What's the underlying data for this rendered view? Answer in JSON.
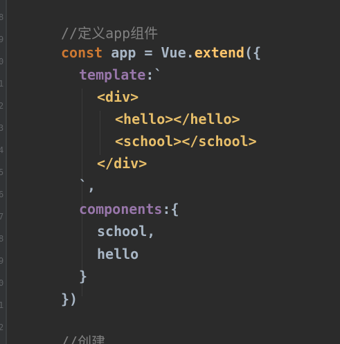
{
  "code_lines": [
    {
      "tokens": [
        {
          "text": "//定义app组件",
          "kind": "comment"
        }
      ]
    },
    {
      "tokens": [
        {
          "text": "const",
          "kind": "keyword"
        },
        {
          "text": " app = ",
          "kind": "var"
        },
        {
          "text": "Vue",
          "kind": "class"
        },
        {
          "text": ".",
          "kind": "punct"
        },
        {
          "text": "extend",
          "kind": "method"
        },
        {
          "text": "({",
          "kind": "punct"
        }
      ]
    },
    {
      "tokens": [
        {
          "text": "template",
          "kind": "prop"
        },
        {
          "text": ":`",
          "kind": "punct"
        }
      ]
    },
    {
      "tokens": [
        {
          "text": "<div>",
          "kind": "tag"
        }
      ]
    },
    {
      "tokens": [
        {
          "text": "<hello></hello>",
          "kind": "tag"
        }
      ]
    },
    {
      "tokens": [
        {
          "text": "<school></school>",
          "kind": "tag"
        }
      ]
    },
    {
      "tokens": [
        {
          "text": "</div>",
          "kind": "tag"
        }
      ]
    },
    {
      "tokens": [
        {
          "text": "`,",
          "kind": "punct"
        }
      ]
    },
    {
      "tokens": [
        {
          "text": "components",
          "kind": "prop"
        },
        {
          "text": ":{",
          "kind": "punct"
        }
      ]
    },
    {
      "tokens": [
        {
          "text": "school,",
          "kind": "var"
        }
      ]
    },
    {
      "tokens": [
        {
          "text": "hello",
          "kind": "var"
        }
      ]
    },
    {
      "tokens": [
        {
          "text": "}",
          "kind": "punct"
        }
      ]
    },
    {
      "tokens": [
        {
          "text": "})",
          "kind": "punct"
        }
      ]
    },
    {
      "tokens": [
        {
          "text": "//创建",
          "kind": "comment"
        }
      ]
    }
  ],
  "gutter_numbers": [
    "8",
    "9",
    "0",
    "1",
    "2",
    "3",
    "4",
    "5",
    "6",
    "7",
    "8",
    "9",
    "0",
    "1",
    "2"
  ],
  "colors": {
    "background": "#2b2b2b",
    "comment": "#808080",
    "keyword": "#cc7832",
    "property": "#9876aa",
    "tag": "#e8bf6a",
    "method": "#ffc66d",
    "text": "#a9b7c6"
  }
}
